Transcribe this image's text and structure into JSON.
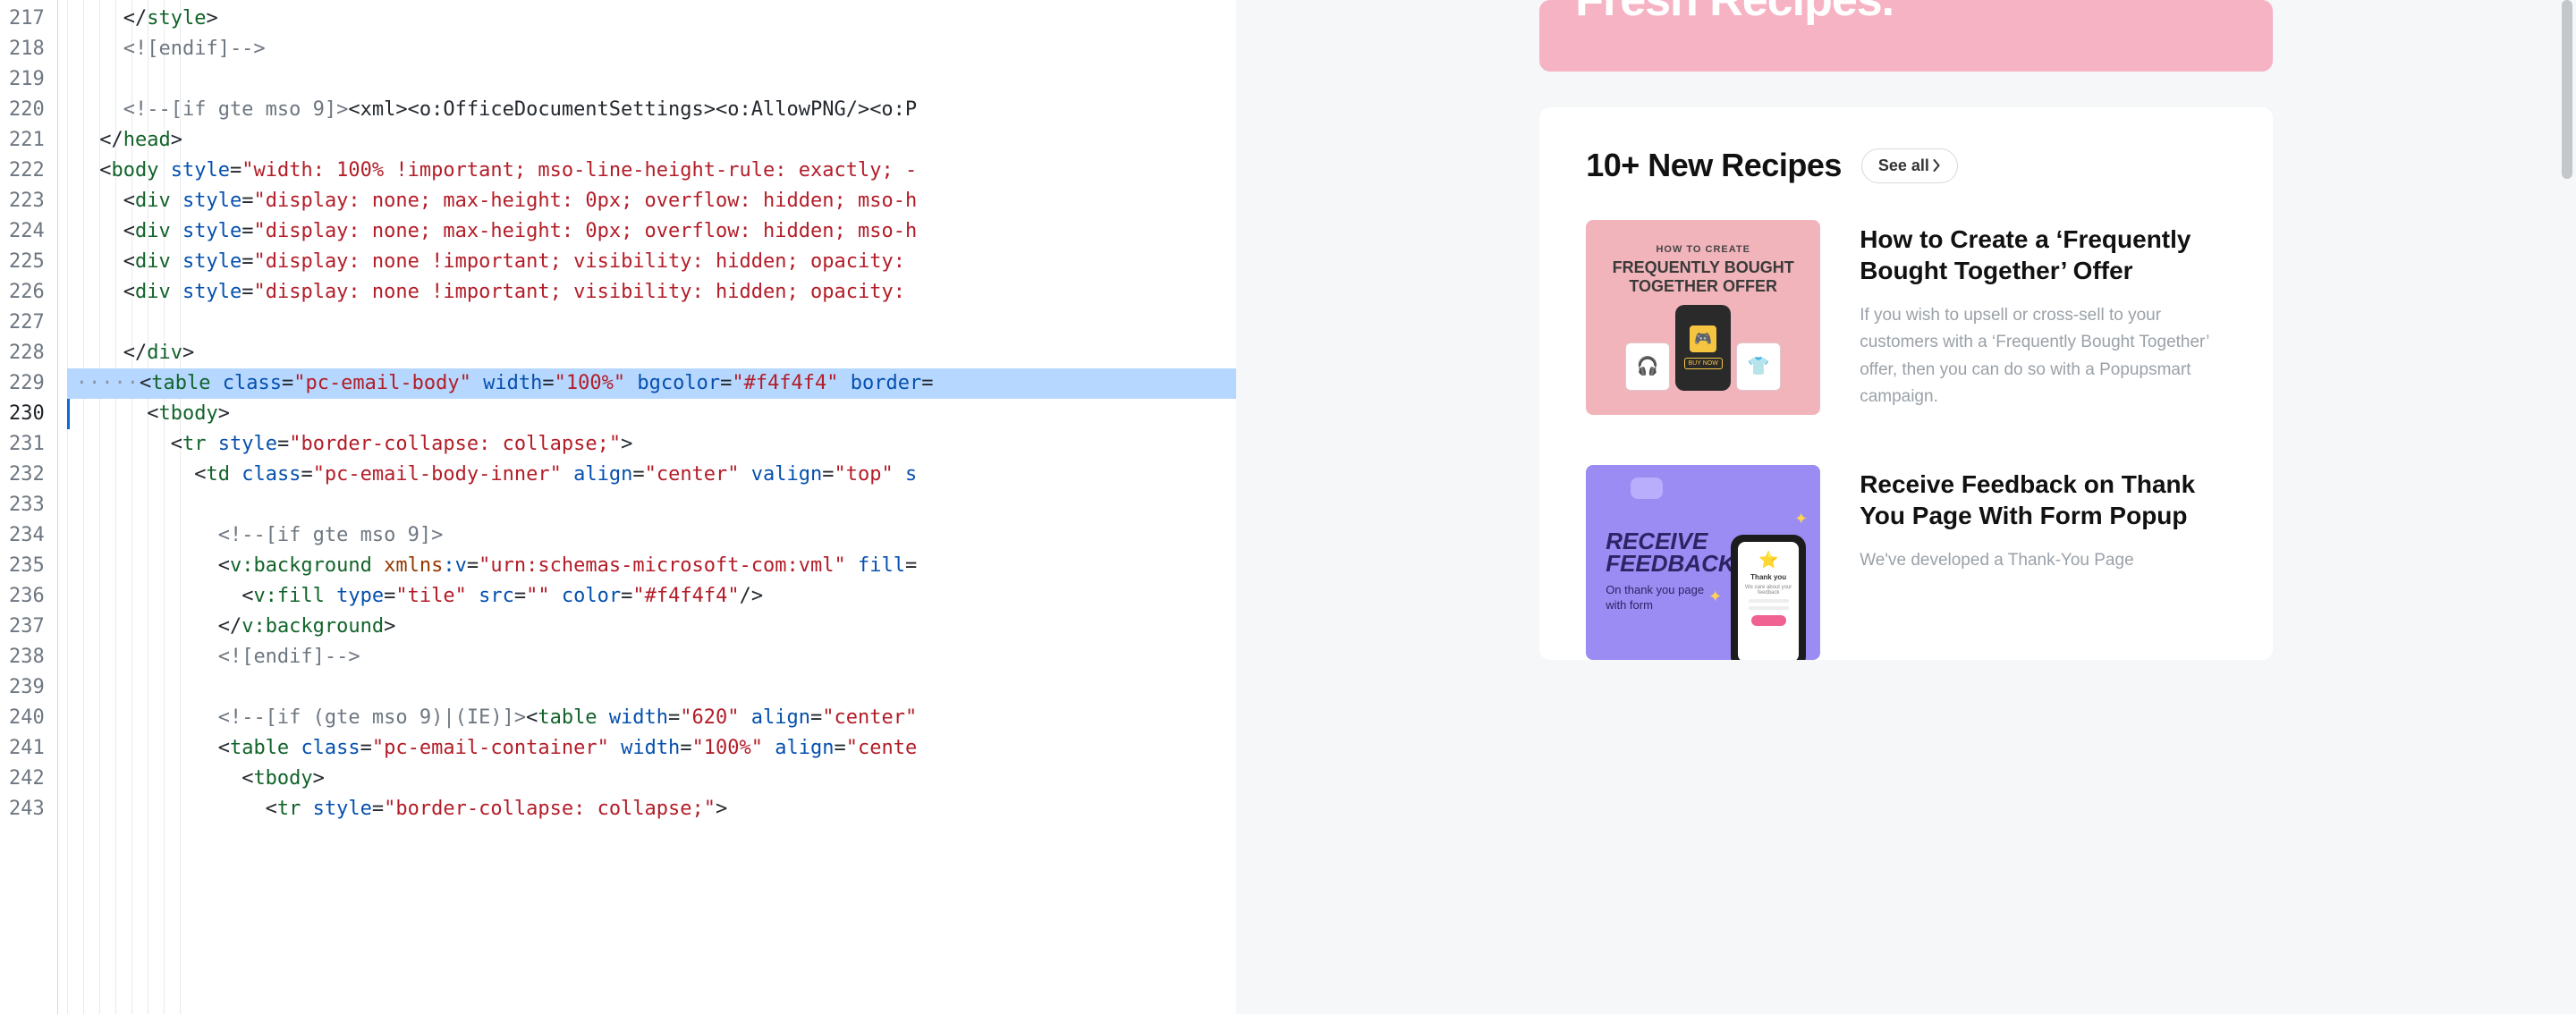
{
  "editor": {
    "first_line": 217,
    "last_line": 243,
    "highlighted_line": 229,
    "cursor_line": 230,
    "lines": {
      "l217": {
        "indent": 2,
        "tokens": [
          {
            "c": "pun",
            "t": "</"
          },
          {
            "c": "tag",
            "t": "style"
          },
          {
            "c": "pun",
            "t": ">"
          }
        ]
      },
      "l218": {
        "indent": 2,
        "tokens": [
          {
            "c": "cmt",
            "t": "<![endif]-->"
          }
        ]
      },
      "l219": {
        "indent": 0,
        "tokens": []
      },
      "l220": {
        "indent": 2,
        "tokens": [
          {
            "c": "cmt",
            "t": "<!--[if gte mso 9]>"
          },
          {
            "c": "pun",
            "t": "<xml><o:OfficeDocumentSettings><o:AllowPNG/><o:P"
          }
        ]
      },
      "l221": {
        "indent": 1,
        "tokens": [
          {
            "c": "pun",
            "t": "</"
          },
          {
            "c": "tag",
            "t": "head"
          },
          {
            "c": "pun",
            "t": ">"
          }
        ]
      },
      "l222": {
        "indent": 1,
        "tokens": [
          {
            "c": "pun",
            "t": "<"
          },
          {
            "c": "tag",
            "t": "body"
          },
          {
            "c": "pun",
            "t": " "
          },
          {
            "c": "attr",
            "t": "style"
          },
          {
            "c": "pun",
            "t": "="
          },
          {
            "c": "str",
            "t": "\"width: 100% !important; mso-line-height-rule: exactly; -"
          }
        ]
      },
      "l223": {
        "indent": 2,
        "tokens": [
          {
            "c": "pun",
            "t": "<"
          },
          {
            "c": "tag",
            "t": "div"
          },
          {
            "c": "pun",
            "t": " "
          },
          {
            "c": "attr",
            "t": "style"
          },
          {
            "c": "pun",
            "t": "="
          },
          {
            "c": "str",
            "t": "\"display: none; max-height: 0px; overflow: hidden; mso-h"
          }
        ]
      },
      "l224": {
        "indent": 2,
        "tokens": [
          {
            "c": "pun",
            "t": "<"
          },
          {
            "c": "tag",
            "t": "div"
          },
          {
            "c": "pun",
            "t": " "
          },
          {
            "c": "attr",
            "t": "style"
          },
          {
            "c": "pun",
            "t": "="
          },
          {
            "c": "str",
            "t": "\"display: none; max-height: 0px; overflow: hidden; mso-h"
          }
        ]
      },
      "l225": {
        "indent": 2,
        "tokens": [
          {
            "c": "pun",
            "t": "<"
          },
          {
            "c": "tag",
            "t": "div"
          },
          {
            "c": "pun",
            "t": " "
          },
          {
            "c": "attr",
            "t": "style"
          },
          {
            "c": "pun",
            "t": "="
          },
          {
            "c": "str",
            "t": "\"display: none !important; visibility: hidden; opacity:"
          }
        ]
      },
      "l226": {
        "indent": 2,
        "tokens": [
          {
            "c": "pun",
            "t": "<"
          },
          {
            "c": "tag",
            "t": "div"
          },
          {
            "c": "pun",
            "t": " "
          },
          {
            "c": "attr",
            "t": "style"
          },
          {
            "c": "pun",
            "t": "="
          },
          {
            "c": "str",
            "t": "\"display: none !important; visibility: hidden; opacity:"
          }
        ]
      },
      "l227": {
        "indent": 2,
        "tokens": []
      },
      "l228": {
        "indent": 2,
        "tokens": [
          {
            "c": "pun",
            "t": "</"
          },
          {
            "c": "tag",
            "t": "div"
          },
          {
            "c": "pun",
            "t": ">"
          }
        ]
      },
      "l229": {
        "indent": 2,
        "dots": true,
        "tokens": [
          {
            "c": "pun",
            "t": "<"
          },
          {
            "c": "tag",
            "t": "table"
          },
          {
            "c": "pun",
            "t": " "
          },
          {
            "c": "attr",
            "t": "class"
          },
          {
            "c": "pun",
            "t": "="
          },
          {
            "c": "str",
            "t": "\"pc-email-body\""
          },
          {
            "c": "pun",
            "t": " "
          },
          {
            "c": "attr",
            "t": "width"
          },
          {
            "c": "pun",
            "t": "="
          },
          {
            "c": "str",
            "t": "\"100%\""
          },
          {
            "c": "pun",
            "t": " "
          },
          {
            "c": "attr",
            "t": "bgcolor"
          },
          {
            "c": "pun",
            "t": "="
          },
          {
            "c": "str",
            "t": "\"#f4f4f4\""
          },
          {
            "c": "pun",
            "t": " "
          },
          {
            "c": "attr",
            "t": "border"
          },
          {
            "c": "pun",
            "t": "="
          }
        ]
      },
      "l230": {
        "indent": 3,
        "tokens": [
          {
            "c": "pun",
            "t": "<"
          },
          {
            "c": "tag",
            "t": "tbody"
          },
          {
            "c": "pun",
            "t": ">"
          }
        ]
      },
      "l231": {
        "indent": 4,
        "tokens": [
          {
            "c": "pun",
            "t": "<"
          },
          {
            "c": "tag",
            "t": "tr"
          },
          {
            "c": "pun",
            "t": " "
          },
          {
            "c": "attr",
            "t": "style"
          },
          {
            "c": "pun",
            "t": "="
          },
          {
            "c": "str",
            "t": "\"border-collapse: collapse;\""
          },
          {
            "c": "pun",
            "t": ">"
          }
        ]
      },
      "l232": {
        "indent": 5,
        "tokens": [
          {
            "c": "pun",
            "t": "<"
          },
          {
            "c": "tag",
            "t": "td"
          },
          {
            "c": "pun",
            "t": " "
          },
          {
            "c": "attr",
            "t": "class"
          },
          {
            "c": "pun",
            "t": "="
          },
          {
            "c": "str",
            "t": "\"pc-email-body-inner\""
          },
          {
            "c": "pun",
            "t": " "
          },
          {
            "c": "attr",
            "t": "align"
          },
          {
            "c": "pun",
            "t": "="
          },
          {
            "c": "str",
            "t": "\"center\""
          },
          {
            "c": "pun",
            "t": " "
          },
          {
            "c": "attr",
            "t": "valign"
          },
          {
            "c": "pun",
            "t": "="
          },
          {
            "c": "str",
            "t": "\"top\""
          },
          {
            "c": "pun",
            "t": " "
          },
          {
            "c": "attr",
            "t": "s"
          }
        ]
      },
      "l233": {
        "indent": 5,
        "tokens": []
      },
      "l234": {
        "indent": 6,
        "tokens": [
          {
            "c": "cmt",
            "t": "<!--[if gte mso 9]>"
          }
        ]
      },
      "l235": {
        "indent": 6,
        "tokens": [
          {
            "c": "pun",
            "t": "<"
          },
          {
            "c": "tag",
            "t": "v:background"
          },
          {
            "c": "pun",
            "t": " "
          },
          {
            "c": "nam",
            "t": "xmlns"
          },
          {
            "c": "attr",
            "t": ":v"
          },
          {
            "c": "pun",
            "t": "="
          },
          {
            "c": "str",
            "t": "\"urn:schemas-microsoft-com:vml\""
          },
          {
            "c": "pun",
            "t": " "
          },
          {
            "c": "attr",
            "t": "fill"
          },
          {
            "c": "pun",
            "t": "="
          }
        ]
      },
      "l236": {
        "indent": 7,
        "tokens": [
          {
            "c": "pun",
            "t": "<"
          },
          {
            "c": "tag",
            "t": "v:fill"
          },
          {
            "c": "pun",
            "t": " "
          },
          {
            "c": "attr",
            "t": "type"
          },
          {
            "c": "pun",
            "t": "="
          },
          {
            "c": "str",
            "t": "\"tile\""
          },
          {
            "c": "pun",
            "t": " "
          },
          {
            "c": "attr",
            "t": "src"
          },
          {
            "c": "pun",
            "t": "="
          },
          {
            "c": "str",
            "t": "\"\""
          },
          {
            "c": "pun",
            "t": " "
          },
          {
            "c": "attr",
            "t": "color"
          },
          {
            "c": "pun",
            "t": "="
          },
          {
            "c": "str",
            "t": "\"#f4f4f4\""
          },
          {
            "c": "pun",
            "t": "/>"
          }
        ]
      },
      "l237": {
        "indent": 6,
        "tokens": [
          {
            "c": "pun",
            "t": "</"
          },
          {
            "c": "tag",
            "t": "v:background"
          },
          {
            "c": "pun",
            "t": ">"
          }
        ]
      },
      "l238": {
        "indent": 6,
        "tokens": [
          {
            "c": "cmt",
            "t": "<![endif]-->"
          }
        ]
      },
      "l239": {
        "indent": 6,
        "tokens": []
      },
      "l240": {
        "indent": 6,
        "tokens": [
          {
            "c": "cmt",
            "t": "<!--[if (gte mso 9)|(IE)]>"
          },
          {
            "c": "pun",
            "t": "<"
          },
          {
            "c": "tag",
            "t": "table"
          },
          {
            "c": "pun",
            "t": " "
          },
          {
            "c": "attr",
            "t": "width"
          },
          {
            "c": "pun",
            "t": "="
          },
          {
            "c": "str",
            "t": "\"620\""
          },
          {
            "c": "pun",
            "t": " "
          },
          {
            "c": "attr",
            "t": "align"
          },
          {
            "c": "pun",
            "t": "="
          },
          {
            "c": "str",
            "t": "\"center\""
          }
        ]
      },
      "l241": {
        "indent": 6,
        "tokens": [
          {
            "c": "pun",
            "t": "<"
          },
          {
            "c": "tag",
            "t": "table"
          },
          {
            "c": "pun",
            "t": " "
          },
          {
            "c": "attr",
            "t": "class"
          },
          {
            "c": "pun",
            "t": "="
          },
          {
            "c": "str",
            "t": "\"pc-email-container\""
          },
          {
            "c": "pun",
            "t": " "
          },
          {
            "c": "attr",
            "t": "width"
          },
          {
            "c": "pun",
            "t": "="
          },
          {
            "c": "str",
            "t": "\"100%\""
          },
          {
            "c": "pun",
            "t": " "
          },
          {
            "c": "attr",
            "t": "align"
          },
          {
            "c": "pun",
            "t": "="
          },
          {
            "c": "str",
            "t": "\"cente"
          }
        ]
      },
      "l242": {
        "indent": 7,
        "tokens": [
          {
            "c": "pun",
            "t": "<"
          },
          {
            "c": "tag",
            "t": "tbody"
          },
          {
            "c": "pun",
            "t": ">"
          }
        ]
      },
      "l243": {
        "indent": 8,
        "tokens": [
          {
            "c": "pun",
            "t": "<"
          },
          {
            "c": "tag",
            "t": "tr"
          },
          {
            "c": "pun",
            "t": " "
          },
          {
            "c": "attr",
            "t": "style"
          },
          {
            "c": "pun",
            "t": "="
          },
          {
            "c": "str",
            "t": "\"border-collapse: collapse;\""
          },
          {
            "c": "pun",
            "t": ">"
          }
        ]
      }
    }
  },
  "preview": {
    "hero_text_partial": "Fresh Recipes.",
    "card": {
      "title": "10+ New Recipes",
      "see_all_label": "See all",
      "articles": [
        {
          "title": "How to Create a ‘Frequently Bought Together’ Offer",
          "desc": "If you wish to upsell or cross-sell to your customers with a ‘Frequently Bought Together’ offer, then you can do so with a Popupsmart campaign.",
          "thumb": {
            "overline": "HOW TO CREATE",
            "headline": "FREQUENTLY BOUGHT\nTOGETHER OFFER",
            "buy_label": "BUY NOW"
          }
        },
        {
          "title": "Receive Feedback on Thank You Page With Form Popup",
          "desc": "We've developed a Thank-You Page",
          "thumb": {
            "headline": "RECEIVE\nFEEDBACK",
            "sub": "On thank you page with form",
            "screen_title": "Thank you",
            "screen_sub": "We care about your feedback"
          }
        }
      ]
    }
  }
}
